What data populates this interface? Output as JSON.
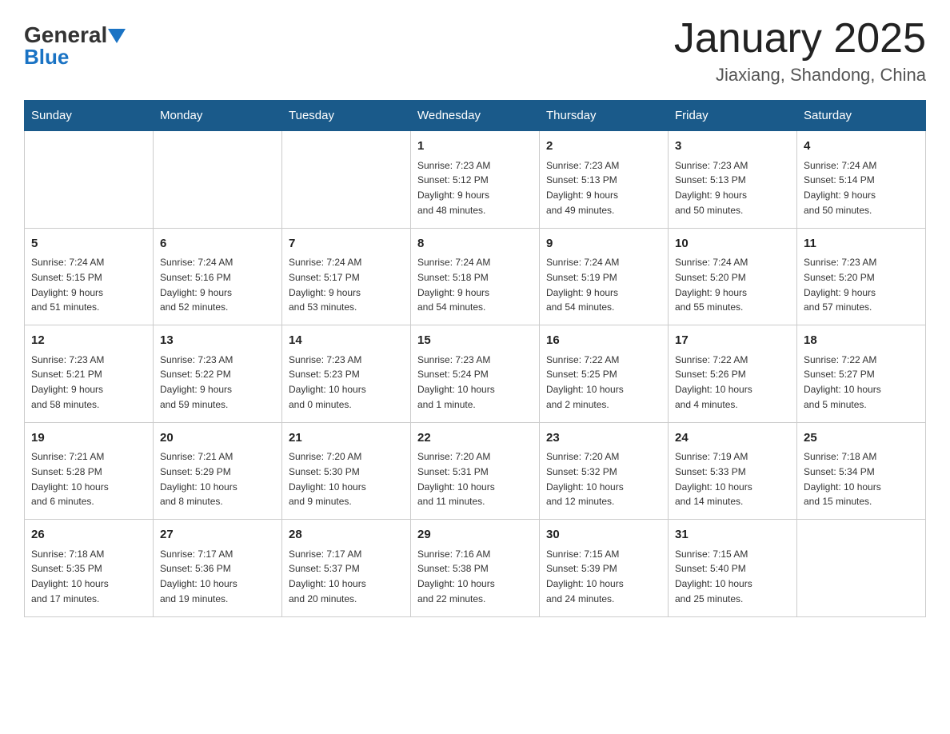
{
  "logo": {
    "general": "General",
    "blue": "Blue",
    "alt": "GeneralBlue logo"
  },
  "title": "January 2025",
  "subtitle": "Jiaxiang, Shandong, China",
  "weekdays": [
    "Sunday",
    "Monday",
    "Tuesday",
    "Wednesday",
    "Thursday",
    "Friday",
    "Saturday"
  ],
  "weeks": [
    [
      {
        "day": "",
        "info": ""
      },
      {
        "day": "",
        "info": ""
      },
      {
        "day": "",
        "info": ""
      },
      {
        "day": "1",
        "info": "Sunrise: 7:23 AM\nSunset: 5:12 PM\nDaylight: 9 hours\nand 48 minutes."
      },
      {
        "day": "2",
        "info": "Sunrise: 7:23 AM\nSunset: 5:13 PM\nDaylight: 9 hours\nand 49 minutes."
      },
      {
        "day": "3",
        "info": "Sunrise: 7:23 AM\nSunset: 5:13 PM\nDaylight: 9 hours\nand 50 minutes."
      },
      {
        "day": "4",
        "info": "Sunrise: 7:24 AM\nSunset: 5:14 PM\nDaylight: 9 hours\nand 50 minutes."
      }
    ],
    [
      {
        "day": "5",
        "info": "Sunrise: 7:24 AM\nSunset: 5:15 PM\nDaylight: 9 hours\nand 51 minutes."
      },
      {
        "day": "6",
        "info": "Sunrise: 7:24 AM\nSunset: 5:16 PM\nDaylight: 9 hours\nand 52 minutes."
      },
      {
        "day": "7",
        "info": "Sunrise: 7:24 AM\nSunset: 5:17 PM\nDaylight: 9 hours\nand 53 minutes."
      },
      {
        "day": "8",
        "info": "Sunrise: 7:24 AM\nSunset: 5:18 PM\nDaylight: 9 hours\nand 54 minutes."
      },
      {
        "day": "9",
        "info": "Sunrise: 7:24 AM\nSunset: 5:19 PM\nDaylight: 9 hours\nand 54 minutes."
      },
      {
        "day": "10",
        "info": "Sunrise: 7:24 AM\nSunset: 5:20 PM\nDaylight: 9 hours\nand 55 minutes."
      },
      {
        "day": "11",
        "info": "Sunrise: 7:23 AM\nSunset: 5:20 PM\nDaylight: 9 hours\nand 57 minutes."
      }
    ],
    [
      {
        "day": "12",
        "info": "Sunrise: 7:23 AM\nSunset: 5:21 PM\nDaylight: 9 hours\nand 58 minutes."
      },
      {
        "day": "13",
        "info": "Sunrise: 7:23 AM\nSunset: 5:22 PM\nDaylight: 9 hours\nand 59 minutes."
      },
      {
        "day": "14",
        "info": "Sunrise: 7:23 AM\nSunset: 5:23 PM\nDaylight: 10 hours\nand 0 minutes."
      },
      {
        "day": "15",
        "info": "Sunrise: 7:23 AM\nSunset: 5:24 PM\nDaylight: 10 hours\nand 1 minute."
      },
      {
        "day": "16",
        "info": "Sunrise: 7:22 AM\nSunset: 5:25 PM\nDaylight: 10 hours\nand 2 minutes."
      },
      {
        "day": "17",
        "info": "Sunrise: 7:22 AM\nSunset: 5:26 PM\nDaylight: 10 hours\nand 4 minutes."
      },
      {
        "day": "18",
        "info": "Sunrise: 7:22 AM\nSunset: 5:27 PM\nDaylight: 10 hours\nand 5 minutes."
      }
    ],
    [
      {
        "day": "19",
        "info": "Sunrise: 7:21 AM\nSunset: 5:28 PM\nDaylight: 10 hours\nand 6 minutes."
      },
      {
        "day": "20",
        "info": "Sunrise: 7:21 AM\nSunset: 5:29 PM\nDaylight: 10 hours\nand 8 minutes."
      },
      {
        "day": "21",
        "info": "Sunrise: 7:20 AM\nSunset: 5:30 PM\nDaylight: 10 hours\nand 9 minutes."
      },
      {
        "day": "22",
        "info": "Sunrise: 7:20 AM\nSunset: 5:31 PM\nDaylight: 10 hours\nand 11 minutes."
      },
      {
        "day": "23",
        "info": "Sunrise: 7:20 AM\nSunset: 5:32 PM\nDaylight: 10 hours\nand 12 minutes."
      },
      {
        "day": "24",
        "info": "Sunrise: 7:19 AM\nSunset: 5:33 PM\nDaylight: 10 hours\nand 14 minutes."
      },
      {
        "day": "25",
        "info": "Sunrise: 7:18 AM\nSunset: 5:34 PM\nDaylight: 10 hours\nand 15 minutes."
      }
    ],
    [
      {
        "day": "26",
        "info": "Sunrise: 7:18 AM\nSunset: 5:35 PM\nDaylight: 10 hours\nand 17 minutes."
      },
      {
        "day": "27",
        "info": "Sunrise: 7:17 AM\nSunset: 5:36 PM\nDaylight: 10 hours\nand 19 minutes."
      },
      {
        "day": "28",
        "info": "Sunrise: 7:17 AM\nSunset: 5:37 PM\nDaylight: 10 hours\nand 20 minutes."
      },
      {
        "day": "29",
        "info": "Sunrise: 7:16 AM\nSunset: 5:38 PM\nDaylight: 10 hours\nand 22 minutes."
      },
      {
        "day": "30",
        "info": "Sunrise: 7:15 AM\nSunset: 5:39 PM\nDaylight: 10 hours\nand 24 minutes."
      },
      {
        "day": "31",
        "info": "Sunrise: 7:15 AM\nSunset: 5:40 PM\nDaylight: 10 hours\nand 25 minutes."
      },
      {
        "day": "",
        "info": ""
      }
    ]
  ]
}
